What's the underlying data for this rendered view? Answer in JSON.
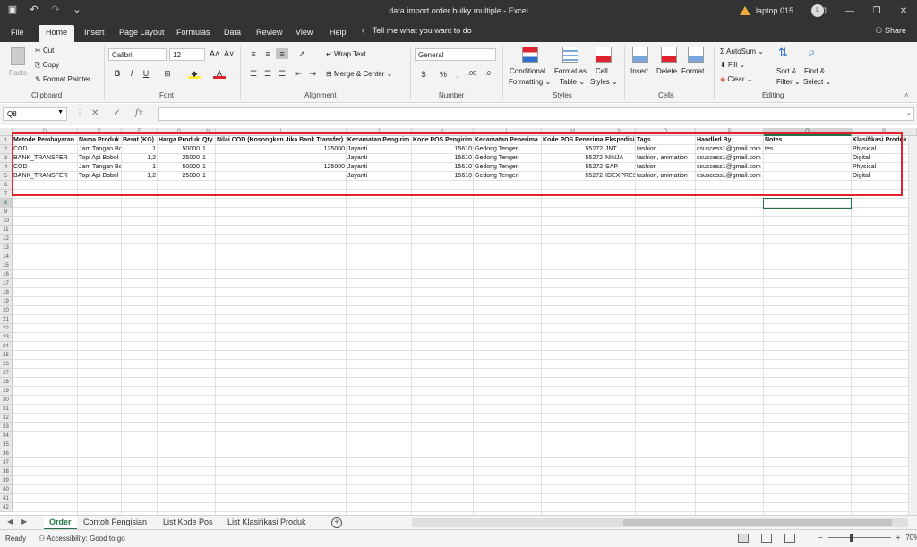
{
  "window": {
    "title": "data import order bulky multiple  -  Excel",
    "user_name": "laptop.015",
    "avatar_initial": "L",
    "controls": [
      "restore-ribbon",
      "minimize",
      "maximize",
      "close"
    ]
  },
  "ribbon_tabs": [
    "File",
    "Home",
    "Insert",
    "Page Layout",
    "Formulas",
    "Data",
    "Review",
    "View",
    "Help"
  ],
  "active_tab": "Home",
  "tell_me": "Tell me what you want to do",
  "share": "Share",
  "clipboard": {
    "paste": "Paste",
    "cut": "Cut",
    "copy": "Copy",
    "format_painter": "Format Painter",
    "label": "Clipboard"
  },
  "font": {
    "name": "Calibri",
    "size": "12",
    "label": "Font",
    "bold": "B",
    "italic": "I",
    "underline": "U"
  },
  "alignment": {
    "wrap_text": "Wrap Text",
    "merge_center": "Merge & Center",
    "label": "Alignment"
  },
  "number": {
    "format": "General",
    "currency": "$",
    "percent": "%",
    "comma": ",",
    "label": "Number"
  },
  "styles": {
    "conditional": "Conditional",
    "conditional2": "Formatting",
    "format_as": "Format as",
    "table": "Table",
    "cell": "Cell",
    "styles": "Styles",
    "label": "Styles"
  },
  "cells": {
    "insert": "Insert",
    "delete": "Delete",
    "format": "Format",
    "label": "Cells"
  },
  "editing": {
    "autosum": "AutoSum",
    "fill": "Fill",
    "clear": "Clear",
    "sort": "Sort &",
    "filter": "Filter",
    "find": "Find &",
    "select": "Select",
    "label": "Editing"
  },
  "formula_bar": {
    "name_box": "Q8",
    "cancel": "✕",
    "enter": "✓",
    "fx": "fx",
    "value": ""
  },
  "grid": {
    "columns": [
      "D",
      "E",
      "F",
      "G",
      "H",
      "I",
      "J",
      "K",
      "L",
      "M",
      "N",
      "O",
      "P",
      "Q",
      "R"
    ],
    "selected_column": "Q",
    "selected_row": "8",
    "rows": [
      "1",
      "2",
      "3",
      "4",
      "5",
      "6",
      "7",
      "8",
      "9",
      "10",
      "11",
      "12",
      "13",
      "14",
      "15",
      "16",
      "17",
      "18",
      "19",
      "20",
      "21",
      "22",
      "23",
      "24",
      "25",
      "26",
      "27",
      "28",
      "29",
      "30",
      "31",
      "32",
      "33",
      "34",
      "35",
      "36",
      "37",
      "38",
      "39",
      "40",
      "41",
      "42"
    ],
    "headers": [
      "Metode Pembayaran",
      "Nama Produk",
      "Berat (KG)",
      "Harga Produk",
      "Qty",
      "Nilai COD (Kosongkan Jika Bank Transfer)",
      "Kecamatan Pengirim",
      "Kode POS Pengirim",
      "Kecamatan Penerima",
      "Kode POS Penerima",
      "Ekspedisi",
      "Tags",
      "Handled By",
      "Notes",
      "Klasifikasi Produk"
    ],
    "data_rows": [
      [
        "COD",
        "Jam Tangan Bc",
        "1",
        "50000",
        "1",
        "125000",
        "Jayanti",
        "15610",
        "Gedong Tengen",
        "55272",
        "JNT",
        "fashion",
        "csuscess1@gmail.com",
        "tes",
        "Physical"
      ],
      [
        "BANK_TRANSFER",
        "Topi Api Bobol",
        "1,2",
        "25000",
        "1",
        "",
        "Jayanti",
        "15610",
        "Gedong Tengen",
        "55272",
        "NINJA",
        "fashion, animation",
        "csuscess1@gmail.com",
        "",
        "Digital"
      ],
      [
        "COD",
        "Jam Tangan Bc",
        "1",
        "50000",
        "1",
        "125000",
        "Jayanti",
        "15610",
        "Gedong Tengen",
        "55272",
        "SAP",
        "fashion",
        "csuscess1@gmail.com",
        "",
        "Physical"
      ],
      [
        "BANK_TRANSFER",
        "Topi Api Bobol",
        "1,2",
        "25000",
        "1",
        "",
        "Jayanti",
        "15610",
        "Gedong Tengen",
        "55272",
        "IDEXPRESS",
        "fashion, animation",
        "csuscess1@gmail.com",
        "",
        "Digital"
      ]
    ]
  },
  "sheets": [
    "Order",
    "Contoh Pengisian",
    "List Kode Pos",
    "List Klasifikasi Produk"
  ],
  "active_sheet": "Order",
  "status": {
    "ready": "Ready",
    "accessibility": "Accessibility: Good to go",
    "zoom": "70%"
  },
  "colors": {
    "excel_green": "#217346",
    "highlight_red": "#e0242f",
    "titlebar": "#333333"
  }
}
